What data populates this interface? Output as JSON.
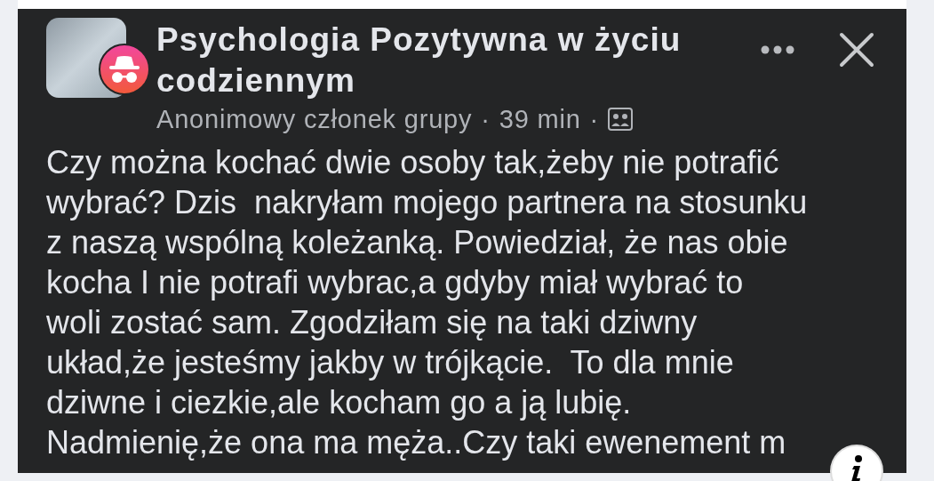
{
  "post": {
    "group_name_lines": [
      "Psychologia Pozytywna w życiu",
      "codziennym"
    ],
    "author": "Anonimowy członek grupy",
    "separator_1": "·",
    "time": "39 min",
    "separator_2": "·",
    "body_lines": [
      "Czy można kochać dwie osoby tak,żeby nie potrafić",
      "wybrać? Dzis  nakryłam mojego partnera na stosunku",
      "z naszą wspólną koleżanką. Powiedział, że nas obie",
      "kocha I nie potrafi wybrac,a gdyby miał wybrać to",
      "woli zostać sam. Zgodziłam się na taki dziwny",
      "układ,że jesteśmy jakby w trójkącie.  To dla mnie",
      "dziwne i ciezkie,ale kocham go a ją lubię.",
      "Nadmienię,że ona ma męża..Czy taki ewenement m"
    ]
  }
}
